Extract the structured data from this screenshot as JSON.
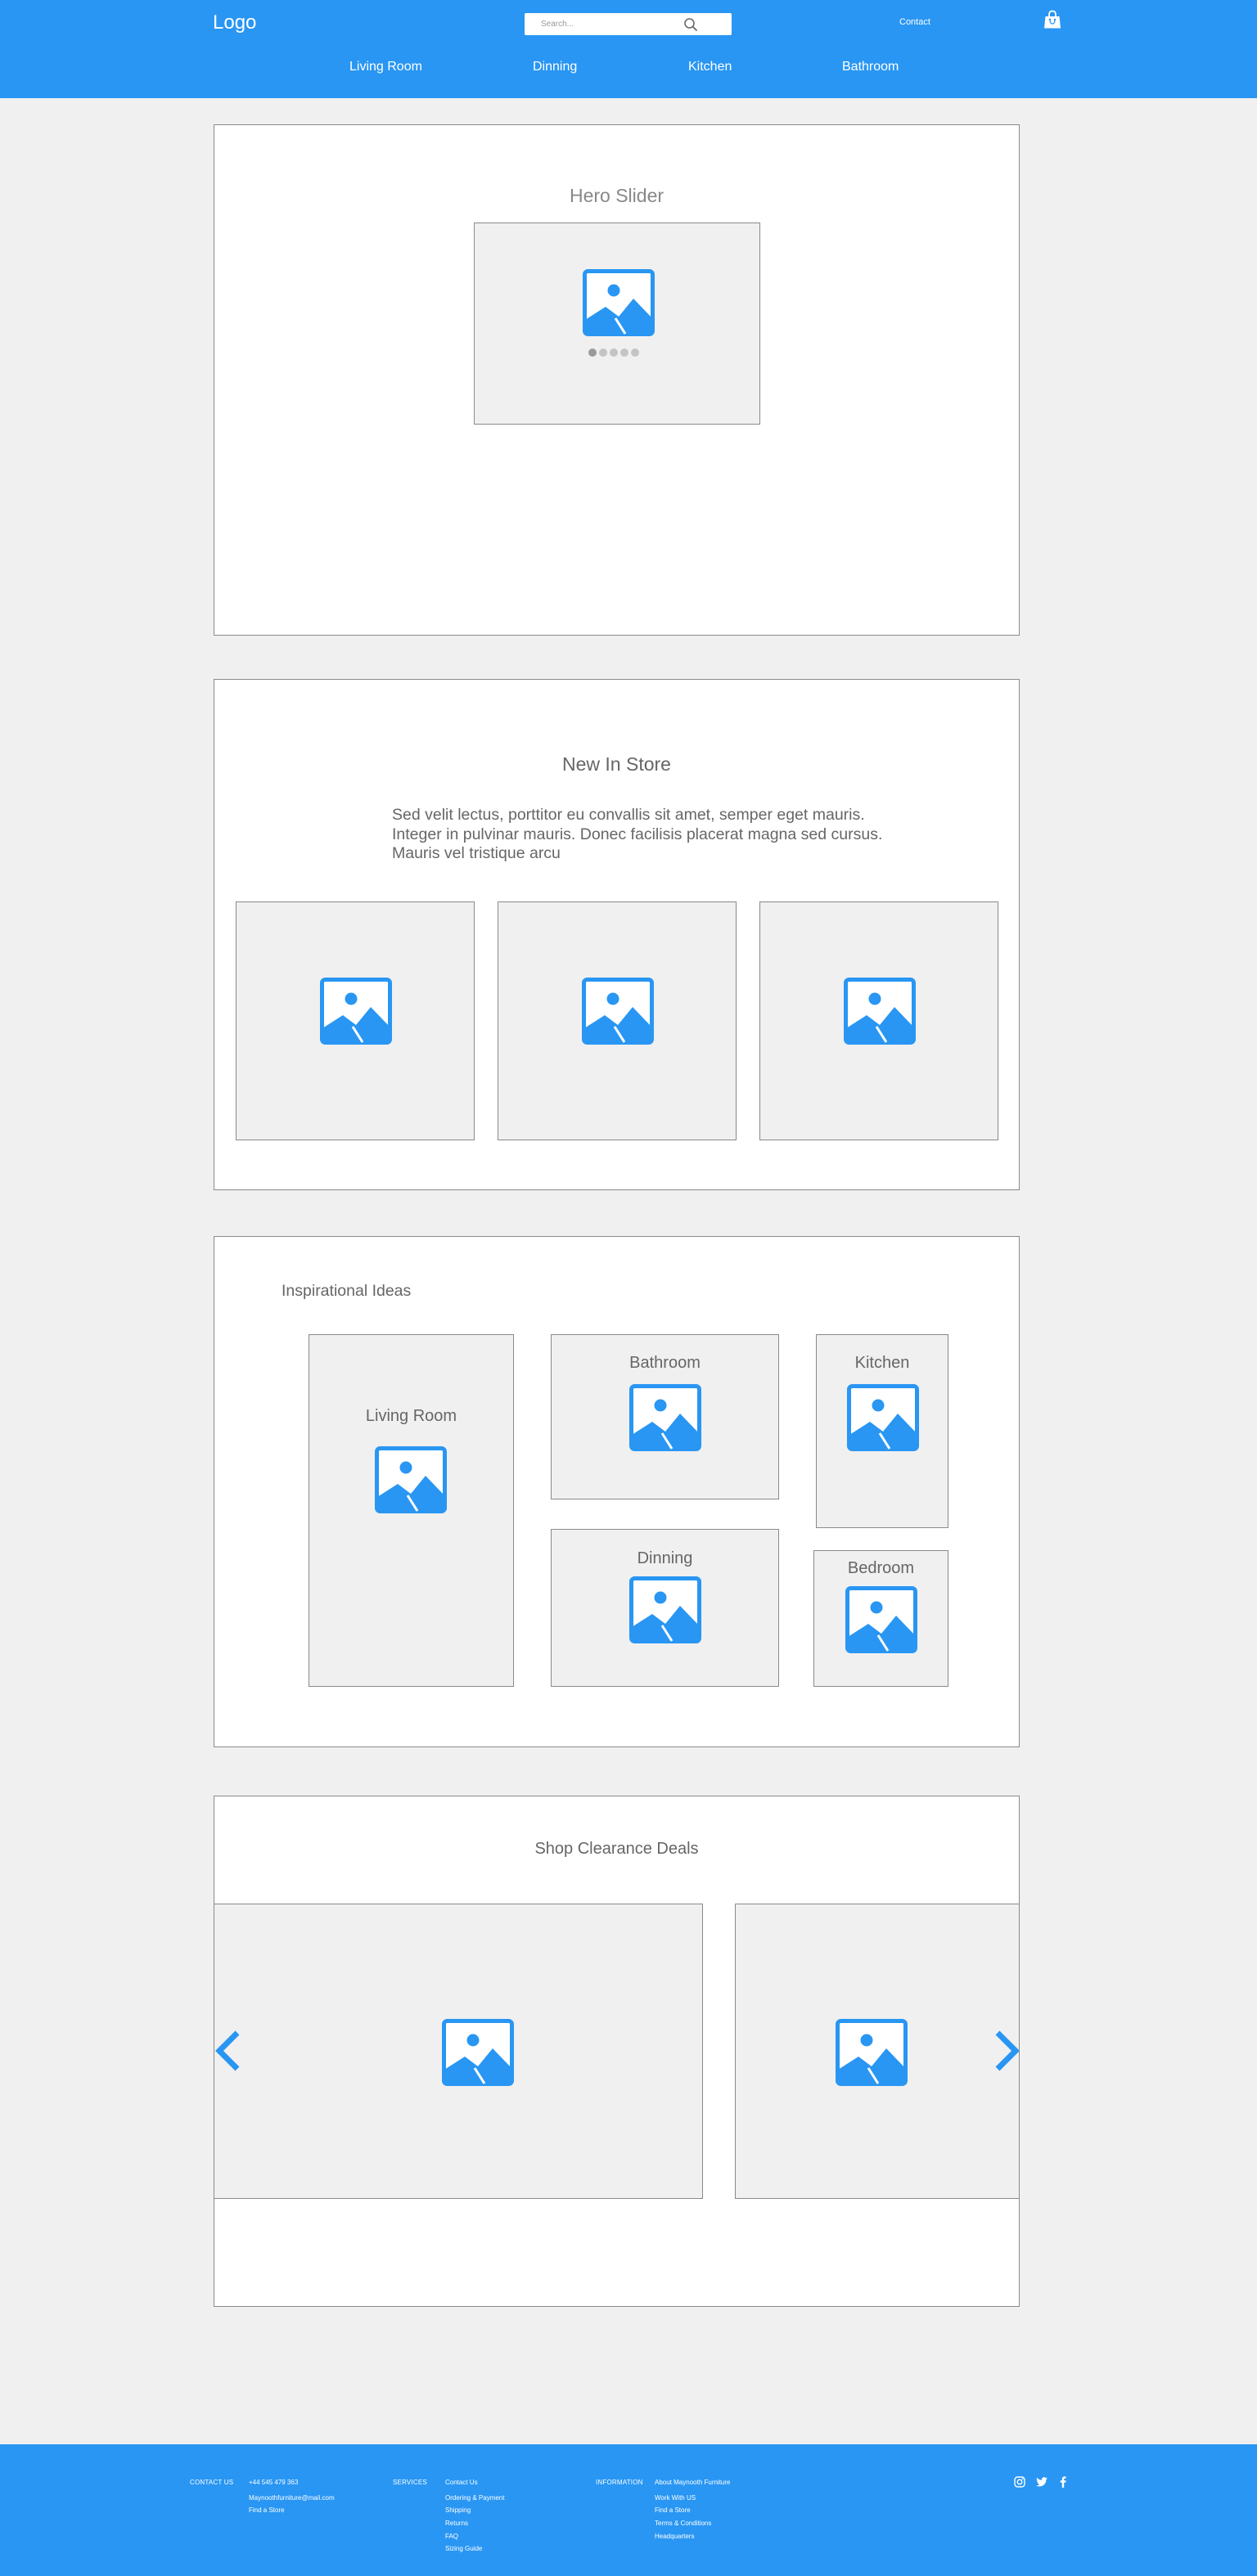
{
  "header": {
    "logo": "Logo",
    "search_placeholder": "Search...",
    "contact": "Contact",
    "nav": [
      {
        "label": "Living Room"
      },
      {
        "label": "Dinning"
      },
      {
        "label": "Kitchen"
      },
      {
        "label": "Bathroom"
      }
    ]
  },
  "hero": {
    "title": "Hero Slider",
    "slide_count": 5,
    "active_slide": 1
  },
  "new_in_store": {
    "title": "New In Store",
    "description": "Sed velit lectus, porttitor eu convallis sit amet, semper eget mauris. Integer in pulvinar mauris. Donec facilisis placerat magna sed cursus. Mauris vel tristique arcu"
  },
  "inspirational": {
    "title": "Inspirational Ideas",
    "cards": {
      "living_room": "Living Room",
      "bathroom": "Bathroom",
      "kitchen": "Kitchen",
      "dinning": "Dinning",
      "bedroom": "Bedroom"
    }
  },
  "clearance": {
    "title": "Shop Clearance Deals"
  },
  "footer": {
    "contact_us": {
      "heading": "CONTACT US",
      "items": [
        "+44 545 479 363",
        "Maynoothfurniture@mail.com",
        "Find a Store"
      ]
    },
    "services": {
      "heading": "SERVICES",
      "items": [
        "Contact Us",
        "Ordering & Payment",
        "Shipping",
        "Returns",
        "FAQ",
        "Sizing Guide"
      ]
    },
    "information": {
      "heading": "INFORMATION",
      "items": [
        "About Maynooth Furniture",
        "Work With US",
        "Find a Store",
        "Terms & Conditions",
        "Headquarters"
      ]
    },
    "social": [
      "instagram-icon",
      "twitter-icon",
      "facebook-icon"
    ]
  },
  "colors": {
    "brand_blue": "#2996f3",
    "page_bg": "#f0f0f0",
    "placeholder_gray": "#f0f0f0",
    "text_gray": "#666666"
  }
}
